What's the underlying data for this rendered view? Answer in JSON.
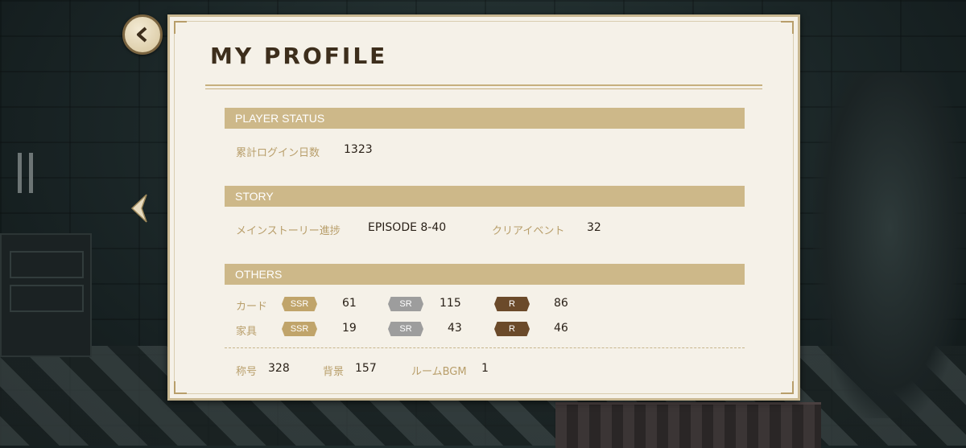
{
  "title": "MY PROFILE",
  "icons": {
    "back": "chevron-left-icon",
    "side": "chevron-left-icon"
  },
  "colors": {
    "section_header": "#cdb889",
    "label": "#b89e6a",
    "ssr": "#c0a46a",
    "sr": "#9d9d9d",
    "r": "#6b4a2a"
  },
  "player_status": {
    "heading": "PLAYER STATUS",
    "login_label": "累計ログイン日数",
    "login_value": "1323"
  },
  "story": {
    "heading": "STORY",
    "main_label": "メインストーリー進捗",
    "main_value": "EPISODE 8-40",
    "event_label": "クリアイベント",
    "event_value": "32"
  },
  "others": {
    "heading": "OTHERS",
    "rows": [
      {
        "label": "カード",
        "ssr": "61",
        "sr": "115",
        "r": "86"
      },
      {
        "label": "家具",
        "ssr": "19",
        "sr": "43",
        "r": "46"
      }
    ],
    "badges": {
      "ssr": "SSR",
      "sr": "SR",
      "r": "R"
    },
    "title_label": "称号",
    "title_value": "328",
    "bg_label": "背景",
    "bg_value": "157",
    "bgm_label": "ルームBGM",
    "bgm_value": "1"
  }
}
